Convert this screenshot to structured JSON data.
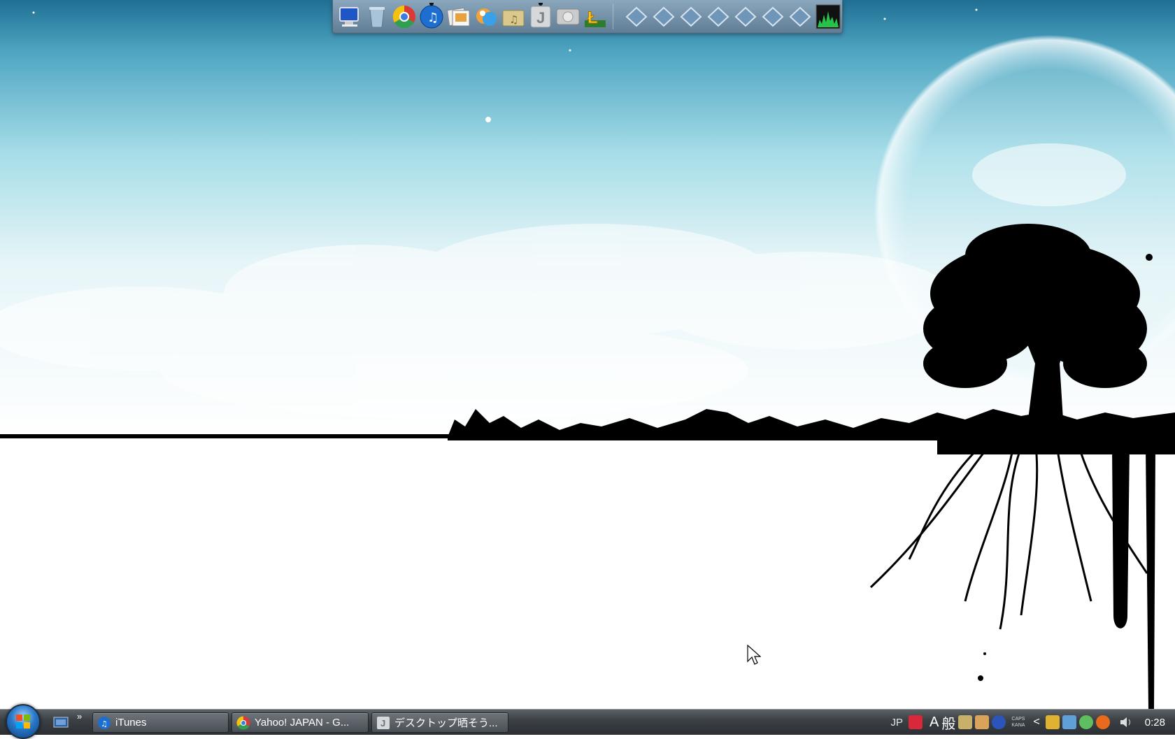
{
  "desktop": {
    "wallpaper": "sky-tree-silhouette",
    "colors": {
      "sky_top": "#1d6f93",
      "sky_mid": "#9fd9e6",
      "ground": "#ffffff",
      "ink": "#000000"
    }
  },
  "dock": {
    "items": [
      {
        "name": "my-computer-icon"
      },
      {
        "name": "recycle-bin-icon"
      },
      {
        "name": "chrome-icon"
      },
      {
        "name": "itunes-icon"
      },
      {
        "name": "photo-viewer-icon"
      },
      {
        "name": "messenger-icon"
      },
      {
        "name": "music-folder-icon"
      },
      {
        "name": "jword-icon",
        "label": "J"
      },
      {
        "name": "disc-drive-icon"
      },
      {
        "name": "app-l-icon",
        "label": "Ł"
      }
    ],
    "stacks": [
      "stack-1",
      "stack-2",
      "stack-3",
      "stack-4",
      "stack-5",
      "stack-6",
      "stack-7"
    ],
    "monitor": "cpu-monitor-icon"
  },
  "taskbar": {
    "start": "windows-start-icon",
    "quick_launch_more": "»",
    "tasks": [
      {
        "label": "iTunes",
        "icon": "itunes-icon"
      },
      {
        "label": "Yahoo! JAPAN - G...",
        "icon": "chrome-icon"
      },
      {
        "label": "デスクトップ晒そう...",
        "icon": "jword-icon"
      }
    ],
    "tray": {
      "language": "JP",
      "ime_mode": "A",
      "ime_type": "般",
      "caps_top": "CAPS",
      "caps_bottom": "KANA",
      "expand": "<",
      "clock": "0:28"
    }
  }
}
